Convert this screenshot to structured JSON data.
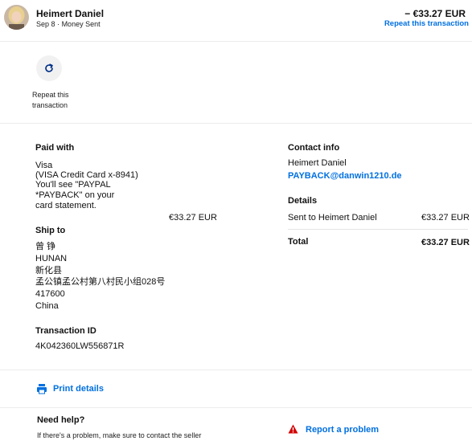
{
  "header": {
    "merchant_name": "Heimert Daniel",
    "date": "Sep 8",
    "separator": "·",
    "type": "Money Sent",
    "amount": "− €33.27 EUR",
    "repeat_link": "Repeat this transaction"
  },
  "repeat": {
    "icon": "repeat-icon",
    "label": "Repeat this transaction"
  },
  "paid_with": {
    "title": "Paid with",
    "method": "Visa",
    "card": "(VISA Credit Card x-8941)",
    "statement_line1": "You'll see \"PAYPAL",
    "statement_line2": "*PAYBACK\" on your",
    "statement_line3": "card statement.",
    "amount": "€33.27 EUR"
  },
  "ship_to": {
    "title": "Ship to",
    "name": "曾 铮",
    "province": "HUNAN",
    "county": "新化县",
    "address": "孟公镇孟公村第八村民小组028号",
    "postal_code": "417600",
    "country": "China"
  },
  "transaction": {
    "title": "Transaction ID",
    "id": "4K042360LW556871R"
  },
  "contact": {
    "title": "Contact info",
    "name": "Heimert Daniel",
    "email": "PAYBACK@danwin1210.de"
  },
  "details": {
    "title": "Details",
    "sent_to_label": "Sent to Heimert Daniel",
    "sent_amount": "€33.27 EUR",
    "total_label": "Total",
    "total_amount": "€33.27 EUR"
  },
  "print": {
    "icon": "printer-icon",
    "label": "Print details"
  },
  "help": {
    "title": "Need help?",
    "text": "If there's a problem, make sure to contact the seller",
    "report_icon": "warning-icon",
    "report_label": "Report a problem"
  },
  "colors": {
    "link": "#0070e0",
    "warning": "#d20000"
  }
}
